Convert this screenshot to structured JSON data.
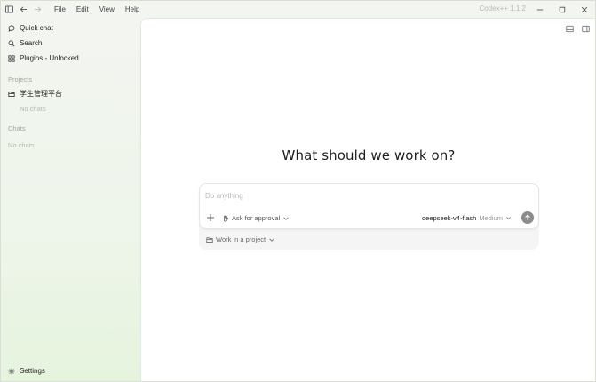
{
  "titlebar": {
    "menu": [
      "File",
      "Edit",
      "View",
      "Help"
    ],
    "app_title": "Codex++ 1.1.2"
  },
  "sidebar": {
    "items": [
      {
        "label": "Quick chat",
        "icon": "chat-bubble-icon"
      },
      {
        "label": "Search",
        "icon": "search-icon"
      },
      {
        "label": "Plugins - Unlocked",
        "icon": "grid-icon"
      }
    ],
    "projects_heading": "Projects",
    "project": {
      "label": "学生管理平台",
      "icon": "folder-icon"
    },
    "project_empty": "No chats",
    "chats_heading": "Chats",
    "chats_empty": "No chats",
    "settings_label": "Settings"
  },
  "main": {
    "headline": "What should we work on?",
    "composer": {
      "placeholder": "Do anything",
      "value": "",
      "approval_label": "Ask for approval",
      "model_name": "deepseek-v4-flash",
      "effort": "Medium",
      "project_label": "Work in a project"
    }
  }
}
